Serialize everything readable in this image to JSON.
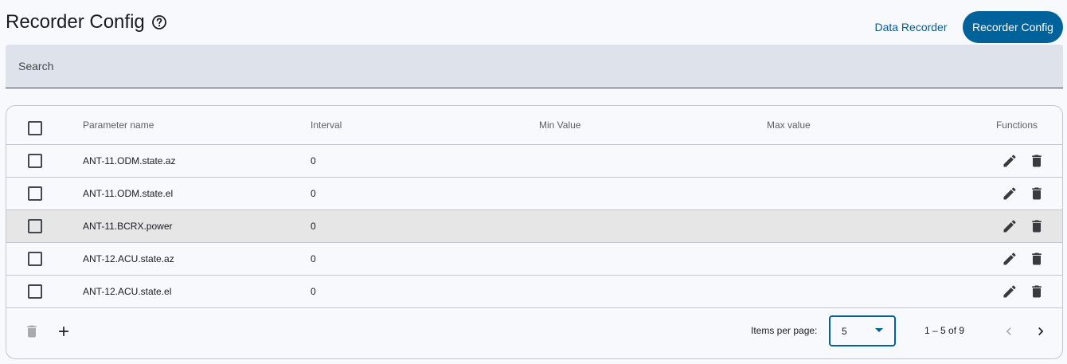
{
  "header": {
    "title": "Recorder Config",
    "help_icon": "help-circle-icon"
  },
  "nav": {
    "data_recorder_label": "Data Recorder",
    "recorder_config_label": "Recorder Config"
  },
  "search": {
    "placeholder": "Search",
    "value": ""
  },
  "table": {
    "columns": {
      "parameter_name": "Parameter name",
      "interval": "Interval",
      "min_value": "Min Value",
      "max_value": "Max value",
      "functions": "Functions"
    },
    "rows": [
      {
        "parameter_name": "ANT-11.ODM.state.az",
        "interval": "0",
        "min_value": "",
        "max_value": ""
      },
      {
        "parameter_name": "ANT-11.ODM.state.el",
        "interval": "0",
        "min_value": "",
        "max_value": ""
      },
      {
        "parameter_name": "ANT-11.BCRX.power",
        "interval": "0",
        "min_value": "",
        "max_value": ""
      },
      {
        "parameter_name": "ANT-12.ACU.state.az",
        "interval": "0",
        "min_value": "",
        "max_value": ""
      },
      {
        "parameter_name": "ANT-12.ACU.state.el",
        "interval": "0",
        "min_value": "",
        "max_value": ""
      }
    ]
  },
  "footer": {
    "items_per_page_label": "Items per page:",
    "items_per_page_value": "5",
    "range_label": "1 – 5 of 9"
  },
  "colors": {
    "primary": "#00629b",
    "link": "#0a5a8a",
    "background": "#f8f9fd",
    "search_bg": "#dee3eb",
    "row_highlight": "#e6e6e6"
  }
}
